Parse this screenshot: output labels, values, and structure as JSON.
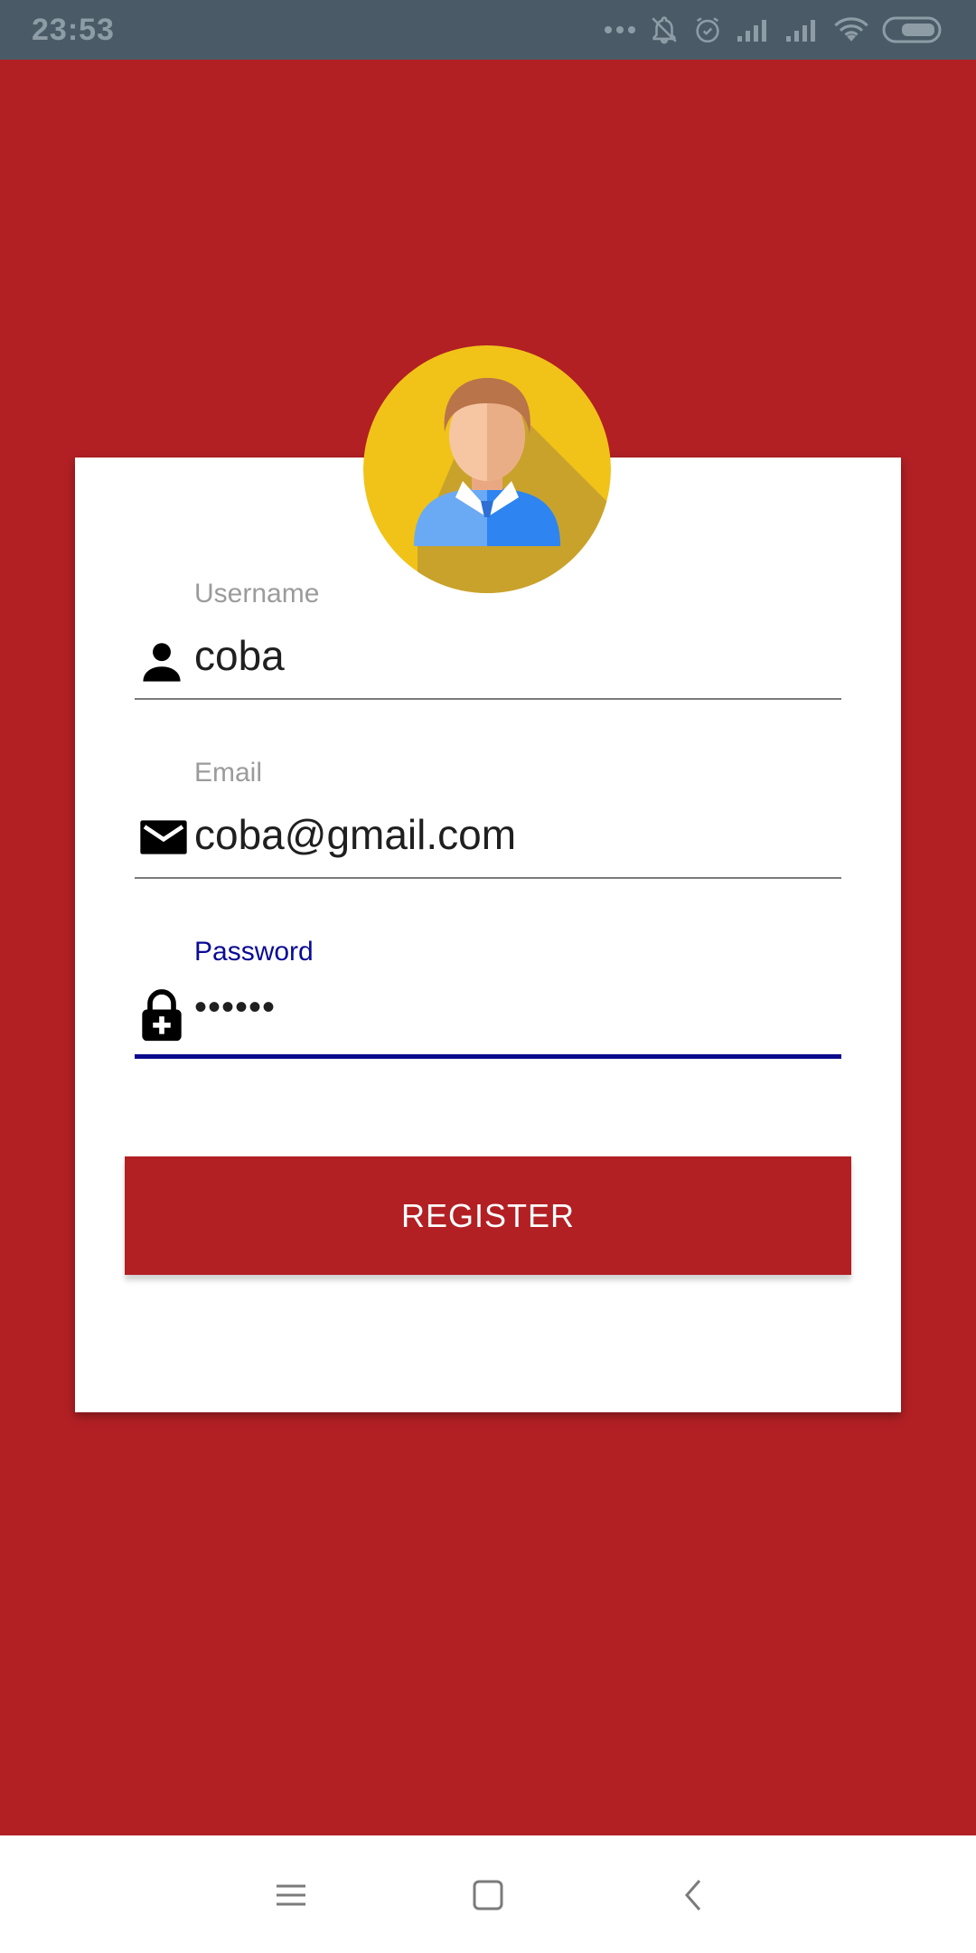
{
  "status_bar": {
    "time": "23:53",
    "icons": [
      "more-dots-icon",
      "notifications-off-icon",
      "alarm-icon",
      "signal-icon",
      "signal-icon",
      "wifi-icon",
      "battery-icon"
    ]
  },
  "form": {
    "username": {
      "label": "Username",
      "value": "coba",
      "icon": "person-icon"
    },
    "email": {
      "label": "Email",
      "value": "coba@gmail.com",
      "icon": "mail-icon"
    },
    "password": {
      "label": "Password",
      "value": "••••••",
      "icon": "lock-plus-icon",
      "focused": true
    },
    "register_label": "REGISTER"
  },
  "nav_bar": {
    "buttons": [
      "menu-icon",
      "home-square-icon",
      "back-chevron-icon"
    ]
  },
  "colors": {
    "background": "#b22024",
    "status_bar": "#4a5b67",
    "card": "#ffffff",
    "button": "#b22024",
    "focus": "#0a0a8c",
    "avatar_bg": "#f1c318"
  }
}
